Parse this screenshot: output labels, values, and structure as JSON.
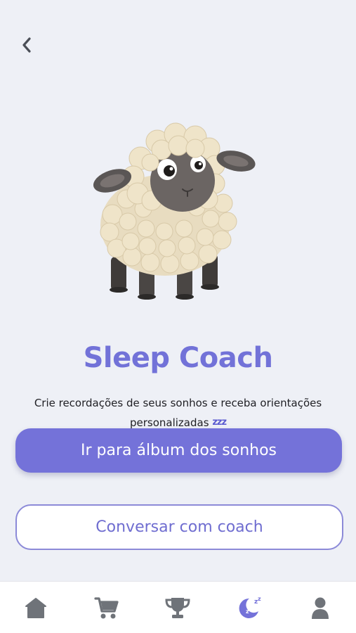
{
  "header": {
    "back_icon": "chevron-left-icon"
  },
  "hero": {
    "image": "sheep-illustration"
  },
  "main": {
    "title": "Sleep Coach",
    "subtitle_line1": "Crie recordações de seus sonhos e receba orientações",
    "subtitle_line2": "personalizadas",
    "subtitle_icon": "zzz",
    "primary_button_label": "Ir para álbum dos sonhos",
    "secondary_button_label": "Conversar com coach"
  },
  "bottom_nav": {
    "items": [
      {
        "icon": "home-icon",
        "active": false
      },
      {
        "icon": "cart-icon",
        "active": false
      },
      {
        "icon": "trophy-icon",
        "active": false
      },
      {
        "icon": "sleep-moon-icon",
        "active": true
      },
      {
        "icon": "user-icon",
        "active": false
      }
    ]
  },
  "colors": {
    "accent": "#7472d9",
    "background": "#eef0f6",
    "nav_inactive": "#6f7379"
  }
}
